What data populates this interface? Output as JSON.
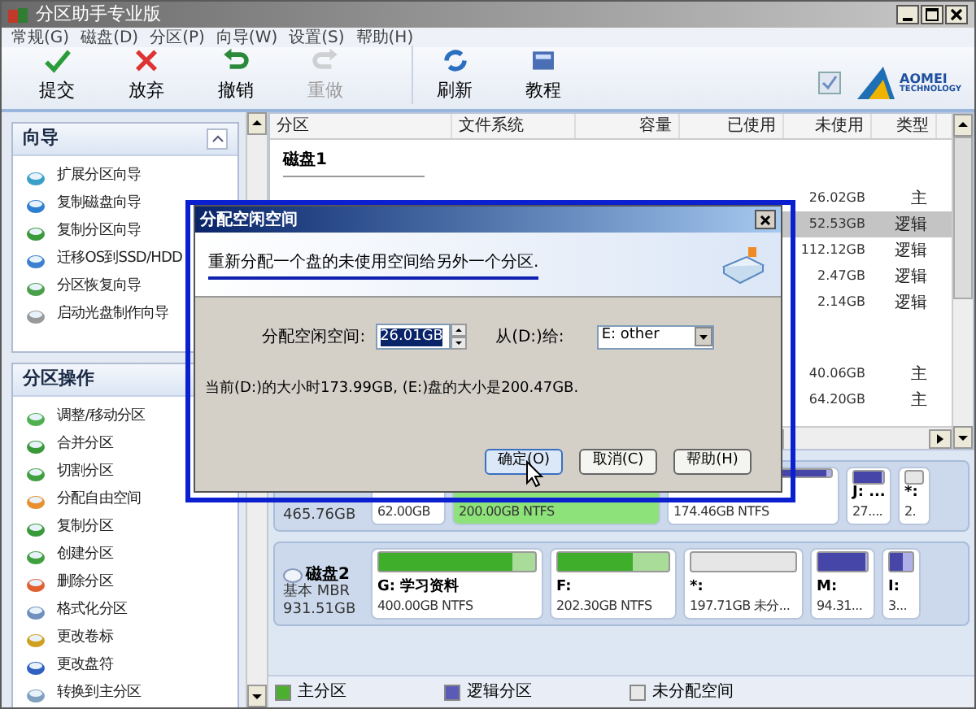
{
  "window": {
    "title": "分区助手专业版"
  },
  "menu": [
    "常规(G)",
    "磁盘(D)",
    "分区(P)",
    "向导(W)",
    "设置(S)",
    "帮助(H)"
  ],
  "toolbar": [
    {
      "label": "提交",
      "disabled": false
    },
    {
      "label": "放弃",
      "disabled": false
    },
    {
      "label": "撤销",
      "disabled": false
    },
    {
      "label": "重做",
      "disabled": true
    },
    {
      "label": "刷新",
      "disabled": false
    },
    {
      "label": "教程",
      "disabled": false
    }
  ],
  "logo": {
    "name": "AOMEI",
    "subtitle": "TECHNOLOGY"
  },
  "sidebar": [
    {
      "title": "向导",
      "items": [
        "扩展分区向导",
        "复制磁盘向导",
        "复制分区向导",
        "迁移OS到SSD/HDD",
        "分区恢复向导",
        "启动光盘制作向导"
      ]
    },
    {
      "title": "分区操作",
      "items": [
        "调整/移动分区",
        "合并分区",
        "切割分区",
        "分配自由空间",
        "复制分区",
        "创建分区",
        "删除分区",
        "格式化分区",
        "更改卷标",
        "更改盘符",
        "转换到主分区"
      ]
    }
  ],
  "table": {
    "columns": [
      "分区",
      "文件系统",
      "容量",
      "已使用",
      "未使用",
      "类型"
    ],
    "groups": [
      {
        "title": "磁盘1",
        "rows": [
          {
            "unused": "26.02GB",
            "type": "主",
            "selected": false
          },
          {
            "unused": "52.53GB",
            "type": "逻辑",
            "selected": true
          },
          {
            "unused": "112.12GB",
            "type": "逻辑",
            "selected": false
          },
          {
            "unused": "2.47GB",
            "type": "逻辑",
            "selected": false
          },
          {
            "unused": "2.14GB",
            "type": "逻辑",
            "selected": false
          }
        ]
      },
      {
        "rows": [
          {
            "unused": "40.06GB",
            "type": "主",
            "selected": false
          },
          {
            "unused": "64.20GB",
            "type": "主",
            "selected": false
          }
        ]
      }
    ]
  },
  "disks": [
    {
      "size": "465.76GB",
      "partitions": [
        {
          "kind": "primary",
          "detail": "62.00GB",
          "selected": false
        },
        {
          "kind": "primary",
          "detail": "200.00GB NTFS",
          "selected": true
        },
        {
          "kind": "logical",
          "detail": "174.46GB NTFS",
          "selected": false,
          "level": 0.97
        },
        {
          "kind": "logical",
          "label": "J: ...",
          "detail": "27....",
          "selected": false,
          "level": 0.95
        },
        {
          "kind": "unallocated",
          "label": "*:",
          "detail": "2.",
          "selected": false
        }
      ]
    },
    {
      "name": "磁盘2",
      "type": "基本 MBR",
      "size": "931.51GB",
      "partitions": [
        {
          "kind": "primary",
          "label": "G: 学习资料",
          "detail": "400.00GB NTFS",
          "selected": false,
          "level": 0.85
        },
        {
          "kind": "primary",
          "label": "F:",
          "detail": "202.30GB NTFS",
          "selected": false,
          "level": 0.68
        },
        {
          "kind": "unallocated",
          "label": "*:",
          "detail": "197.71GB 未分...",
          "selected": false
        },
        {
          "kind": "logical",
          "label": "M:",
          "detail": "94.31...",
          "selected": false,
          "level": 0.95
        },
        {
          "kind": "logical",
          "label": "I:",
          "detail": "3...",
          "selected": false,
          "level": 0.6
        }
      ]
    }
  ],
  "legend": [
    {
      "label": "主分区",
      "color": "#4caf30"
    },
    {
      "label": "逻辑分区",
      "color": "#5a5ab8"
    },
    {
      "label": "未分配空间",
      "color": "#e8e8e8"
    }
  ],
  "dialog": {
    "title": "分配空闲空间",
    "description": "重新分配一个盘的未使用空间给另外一个分区.",
    "amount_label": "分配空闲空间:",
    "amount": "26.01GB",
    "from_label": "从(D:)给:",
    "target": "E: other",
    "info": "当前(D:)的大小时173.99GB, (E:)盘的大小是200.47GB.",
    "buttons": [
      {
        "label": "确定(O)",
        "focused": true
      },
      {
        "label": "取消(C)",
        "focused": false
      },
      {
        "label": "帮助(H)",
        "focused": false
      }
    ]
  }
}
